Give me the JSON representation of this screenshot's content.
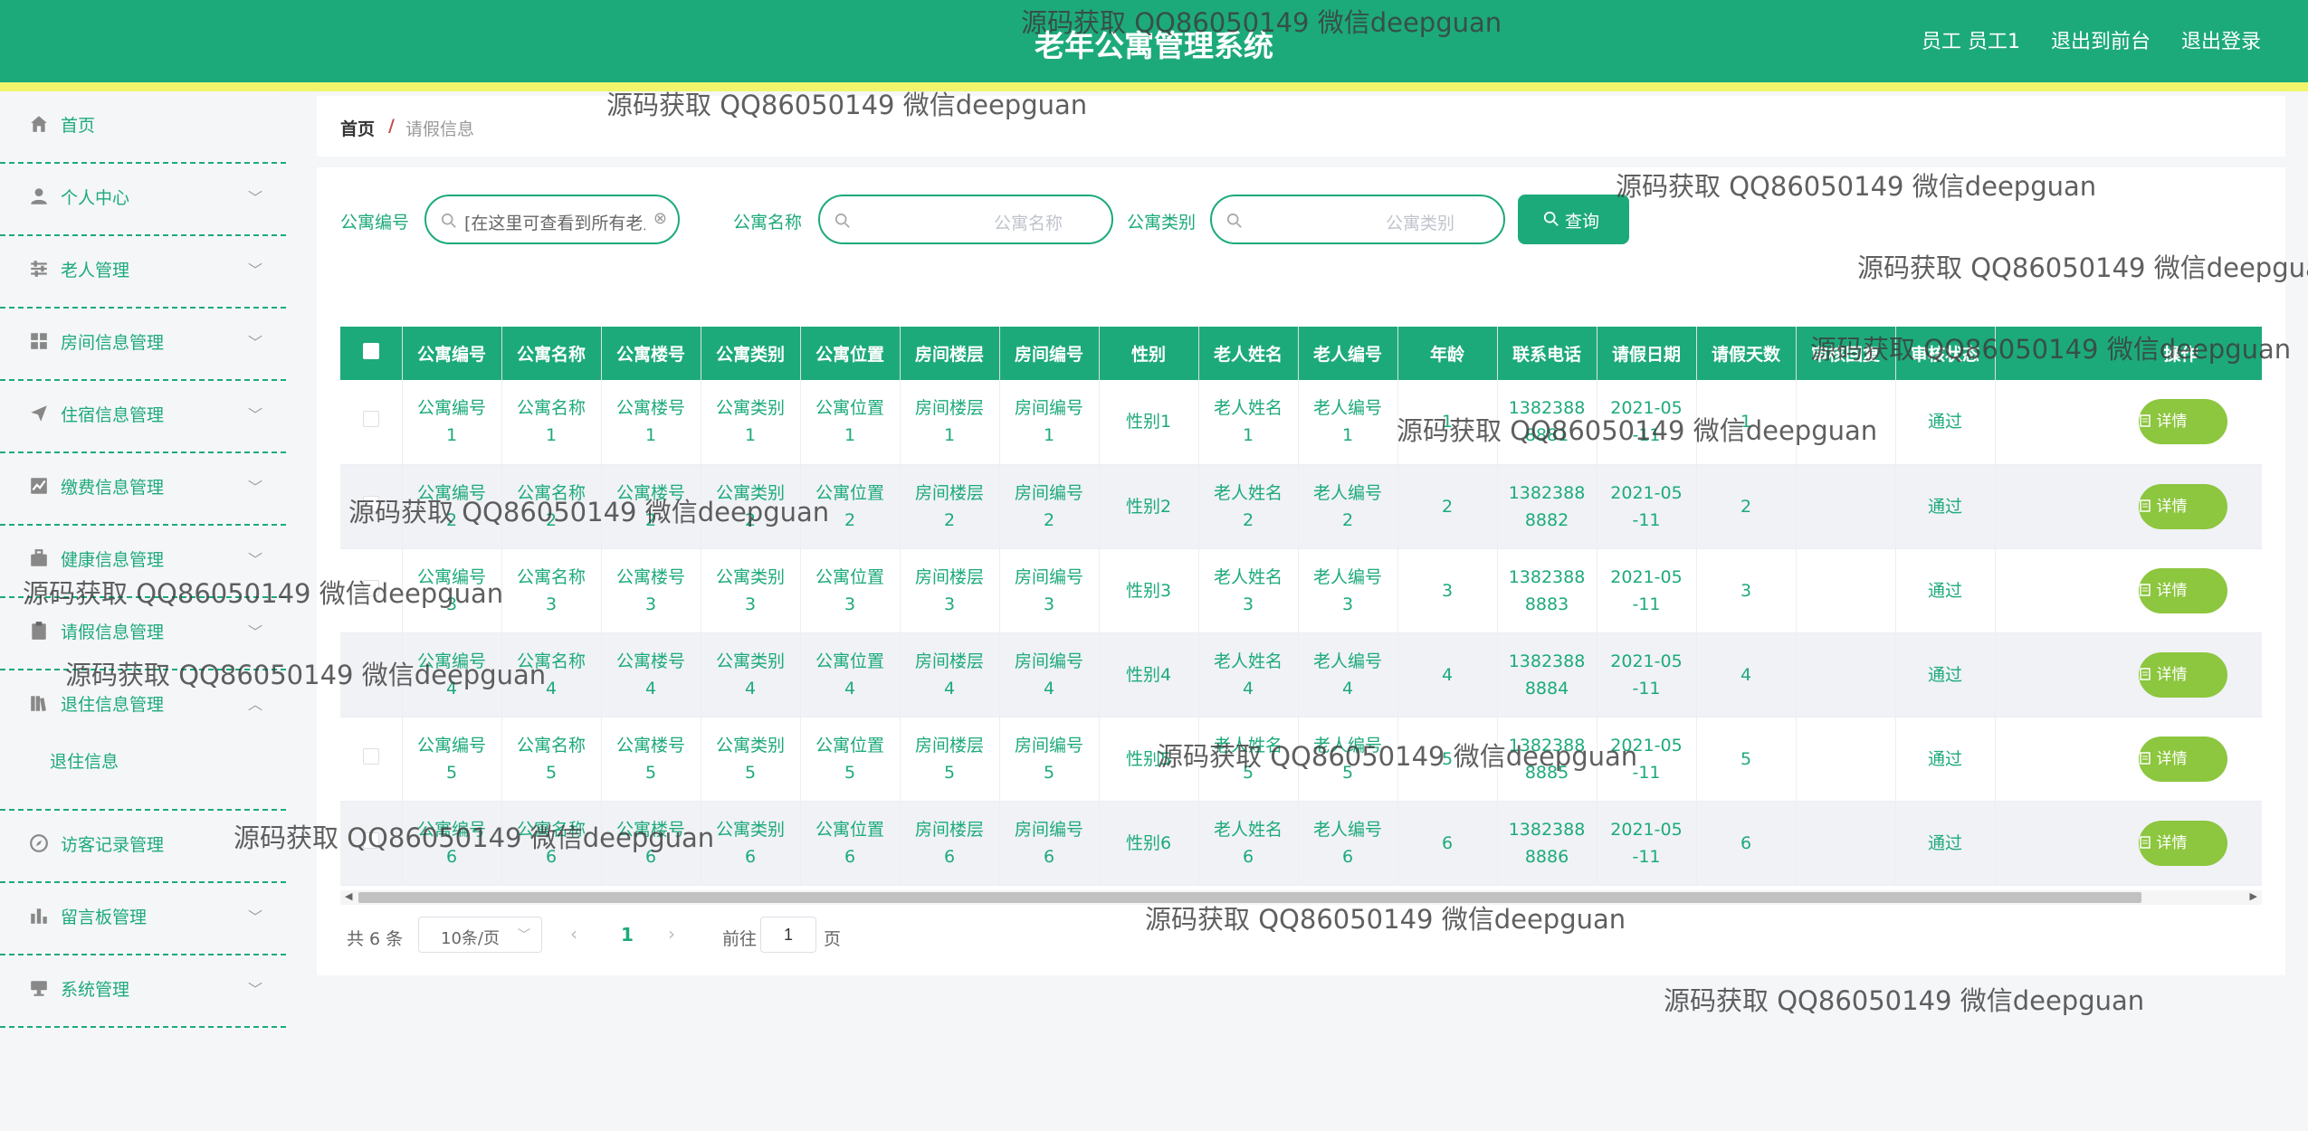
{
  "header": {
    "title": "老年公寓管理系统",
    "links": [
      "员工 员工1",
      "退出到前台",
      "退出登录"
    ]
  },
  "sidebar": {
    "items": [
      {
        "label": "首页",
        "icon": "home-icon"
      },
      {
        "label": "个人中心",
        "icon": "user-icon"
      },
      {
        "label": "老人管理",
        "icon": "sliders-icon"
      },
      {
        "label": "房间信息管理",
        "icon": "grid-icon"
      },
      {
        "label": "住宿信息管理",
        "icon": "paper-plane-icon"
      },
      {
        "label": "缴费信息管理",
        "icon": "chart-icon"
      },
      {
        "label": "健康信息管理",
        "icon": "briefcase-icon"
      },
      {
        "label": "请假信息管理",
        "icon": "clipboard-icon"
      },
      {
        "label": "退住信息管理",
        "icon": "book-icon"
      },
      {
        "label": "访客记录管理",
        "icon": "compass-icon"
      },
      {
        "label": "留言板管理",
        "icon": "bar-chart-icon"
      },
      {
        "label": "系统管理",
        "icon": "monitor-icon"
      }
    ],
    "subitem": "退住信息"
  },
  "breadcrumb": {
    "home": "首页",
    "separator": "/",
    "current": "请假信息"
  },
  "search": {
    "fields": [
      {
        "label": "公寓编号",
        "value": "[在这里可查看到所有老人的",
        "placeholder": ""
      },
      {
        "label": "公寓名称",
        "value": "",
        "placeholder": "公寓名称"
      },
      {
        "label": "公寓类别",
        "value": "",
        "placeholder": "公寓类别"
      }
    ],
    "button": "查询"
  },
  "table": {
    "columns": [
      "公寓编号",
      "公寓名称",
      "公寓楼号",
      "公寓类别",
      "公寓位置",
      "房间楼层",
      "房间编号",
      "性别",
      "老人姓名",
      "老人编号",
      "年龄",
      "联系电话",
      "请假日期",
      "请假天数",
      "审核回复",
      "审核状态",
      "操作"
    ],
    "rows": [
      [
        "公寓编号\n1",
        "公寓名称\n1",
        "公寓楼号\n1",
        "公寓类别\n1",
        "公寓位置\n1",
        "房间楼层\n1",
        "房间编号\n1",
        "性别1",
        "老人姓名\n1",
        "老人编号\n1",
        "1",
        "1382388\n8881",
        "2021-05\n-11",
        "1",
        "",
        "通过"
      ],
      [
        "公寓编号\n2",
        "公寓名称\n2",
        "公寓楼号\n2",
        "公寓类别\n2",
        "公寓位置\n2",
        "房间楼层\n2",
        "房间编号\n2",
        "性别2",
        "老人姓名\n2",
        "老人编号\n2",
        "2",
        "1382388\n8882",
        "2021-05\n-11",
        "2",
        "",
        "通过"
      ],
      [
        "公寓编号\n3",
        "公寓名称\n3",
        "公寓楼号\n3",
        "公寓类别\n3",
        "公寓位置\n3",
        "房间楼层\n3",
        "房间编号\n3",
        "性别3",
        "老人姓名\n3",
        "老人编号\n3",
        "3",
        "1382388\n8883",
        "2021-05\n-11",
        "3",
        "",
        "通过"
      ],
      [
        "公寓编号\n4",
        "公寓名称\n4",
        "公寓楼号\n4",
        "公寓类别\n4",
        "公寓位置\n4",
        "房间楼层\n4",
        "房间编号\n4",
        "性别4",
        "老人姓名\n4",
        "老人编号\n4",
        "4",
        "1382388\n8884",
        "2021-05\n-11",
        "4",
        "",
        "通过"
      ],
      [
        "公寓编号\n5",
        "公寓名称\n5",
        "公寓楼号\n5",
        "公寓类别\n5",
        "公寓位置\n5",
        "房间楼层\n5",
        "房间编号\n5",
        "性别5",
        "老人姓名\n5",
        "老人编号\n5",
        "5",
        "1382388\n8885",
        "2021-05\n-11",
        "5",
        "",
        "通过"
      ],
      [
        "公寓编号\n6",
        "公寓名称\n6",
        "公寓楼号\n6",
        "公寓类别\n6",
        "公寓位置\n6",
        "房间楼层\n6",
        "房间编号\n6",
        "性别6",
        "老人姓名\n6",
        "老人编号\n6",
        "6",
        "1382388\n8886",
        "2021-05\n-11",
        "6",
        "",
        "通过"
      ]
    ],
    "action_label": "详情"
  },
  "pagination": {
    "total": "共 6 条",
    "page_size": "10条/页",
    "current_page": "1",
    "goto": "前往",
    "goto_value": "1",
    "page_suffix": "页"
  },
  "watermark": "源码获取 QQ86050149 微信deepguan",
  "colors": {
    "primary": "#1daa7a",
    "stripe": "#f2f56c",
    "detail_button": "#8dc63f"
  }
}
